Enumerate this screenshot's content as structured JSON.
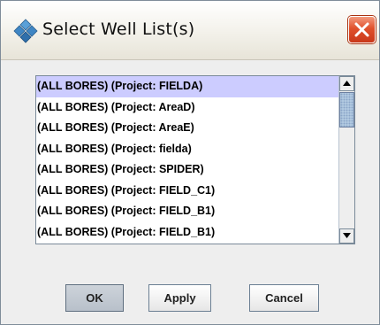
{
  "window": {
    "title": "Select Well List(s)",
    "icons": {
      "app": "app-diamond-icon",
      "close": "close-x-icon"
    },
    "colors": {
      "close_button": "#e0512c",
      "selected_row": "#ccccff",
      "scroll_thumb": "#b8cfe5"
    }
  },
  "well_list": {
    "items": [
      "(ALL BORES) (Project: FIELDA)",
      "(ALL BORES) (Project: AreaD)",
      "(ALL BORES) (Project: AreaE)",
      "(ALL BORES) (Project: fielda)",
      "(ALL BORES) (Project: SPIDER)",
      "(ALL BORES) (Project: FIELD_C1)",
      "(ALL BORES) (Project: FIELD_B1)",
      "(ALL BORES) (Project: FIELD_B1)"
    ],
    "selected_index": 0
  },
  "buttons": {
    "ok": "OK",
    "apply": "Apply",
    "cancel": "Cancel"
  }
}
